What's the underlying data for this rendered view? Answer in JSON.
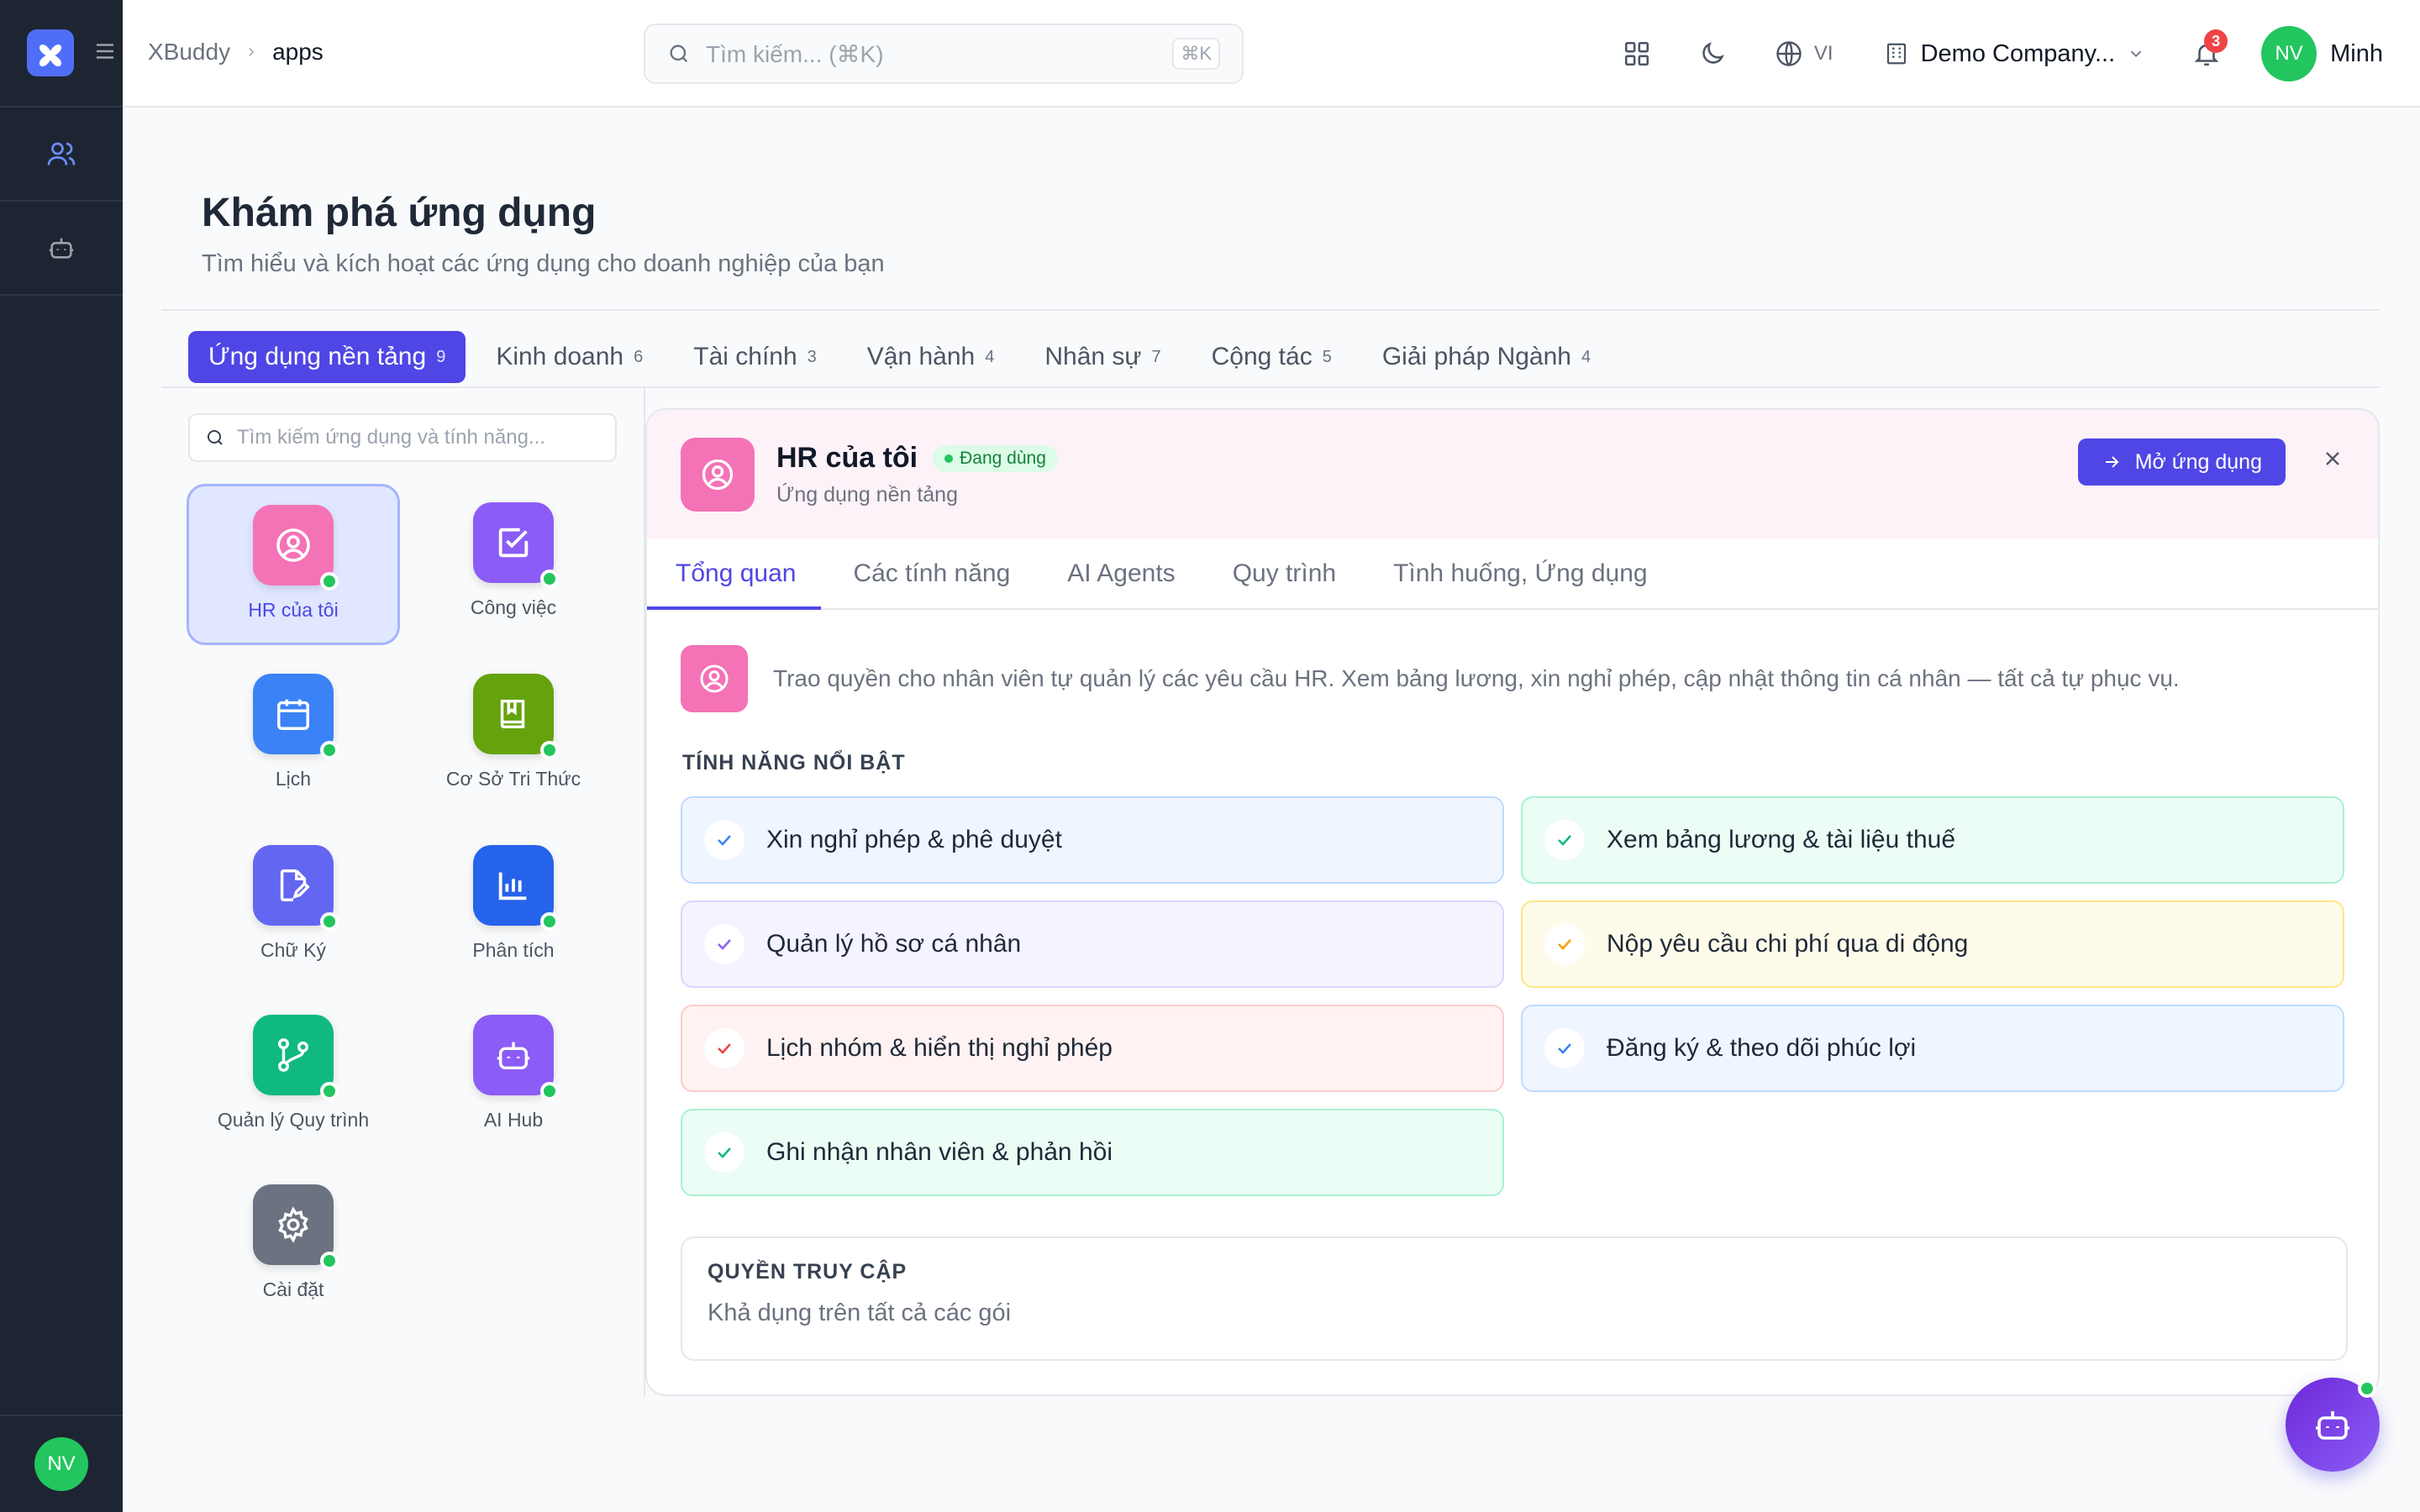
{
  "sidebar": {
    "avatar": "NV"
  },
  "header": {
    "breadcrumb": [
      "XBuddy",
      "apps"
    ],
    "search_placeholder": "Tìm kiếm... (⌘K)",
    "search_shortcut": "⌘K",
    "language": "VI",
    "company": "Demo Company...",
    "notification_count": "3",
    "user_initials": "NV",
    "user_name": "Minh"
  },
  "page": {
    "title": "Khám phá ứng dụng",
    "subtitle": "Tìm hiểu và kích hoạt các ứng dụng cho doanh nghiệp của bạn"
  },
  "categories": [
    {
      "label": "Ứng dụng nền tảng",
      "count": "9"
    },
    {
      "label": "Kinh doanh",
      "count": "6"
    },
    {
      "label": "Tài chính",
      "count": "3"
    },
    {
      "label": "Vận hành",
      "count": "4"
    },
    {
      "label": "Nhân sự",
      "count": "7"
    },
    {
      "label": "Cộng tác",
      "count": "5"
    },
    {
      "label": "Giải pháp Ngành",
      "count": "4"
    }
  ],
  "app_search_placeholder": "Tìm kiếm ứng dụng và tính năng...",
  "apps": [
    {
      "label": "HR của tôi",
      "icon": "user-circle-icon",
      "color": "#f472b6"
    },
    {
      "label": "Công việc",
      "icon": "check-square-icon",
      "color": "#8b5cf6"
    },
    {
      "label": "Lịch",
      "icon": "calendar-icon",
      "color": "#3b82f6"
    },
    {
      "label": "Cơ Sở Tri Thức",
      "icon": "book-icon",
      "color": "#65a30d"
    },
    {
      "label": "Chữ Ký",
      "icon": "signature-icon",
      "color": "#6366f1"
    },
    {
      "label": "Phân tích",
      "icon": "bar-chart-icon",
      "color": "#2563eb"
    },
    {
      "label": "Quản lý Quy trình",
      "icon": "workflow-icon",
      "color": "#10b981"
    },
    {
      "label": "AI Hub",
      "icon": "bot-icon",
      "color": "#8b5cf6"
    },
    {
      "label": "Cài đặt",
      "icon": "gear-icon",
      "color": "#6b7280"
    }
  ],
  "detail": {
    "name": "HR của tôi",
    "status": "Đang dùng",
    "category": "Ứng dụng nền tảng",
    "open_label": "Mở ứng dụng",
    "tabs": [
      "Tổng quan",
      "Các tính năng",
      "AI Agents",
      "Quy trình",
      "Tình huống, Ứng dụng"
    ],
    "description": "Trao quyền cho nhân viên tự quản lý các yêu cầu HR. Xem bảng lương, xin nghỉ phép, cập nhật thông tin cá nhân — tất cả tự phục vụ.",
    "features_heading": "TÍNH NĂNG NỔI BẬT",
    "features": [
      {
        "label": "Xin nghỉ phép & phê duyệt",
        "bg": "#eff6ff",
        "border": "#bfdbfe",
        "check": "#3b82f6"
      },
      {
        "label": "Xem bảng lương & tài liệu thuế",
        "bg": "#ecfdf5",
        "border": "#a7f3d0",
        "check": "#10b981"
      },
      {
        "label": "Quản lý hồ sơ cá nhân",
        "bg": "#f5f3ff",
        "border": "#ddd6fe",
        "check": "#8b5cf6"
      },
      {
        "label": "Nộp yêu cầu chi phí qua di động",
        "bg": "#fffbeb",
        "border": "#fde68a",
        "check": "#f59e0b"
      },
      {
        "label": "Lịch nhóm & hiển thị nghỉ phép",
        "bg": "#fef2f2",
        "border": "#fecaca",
        "check": "#ef4444"
      },
      {
        "label": "Đăng ký & theo dõi phúc lợi",
        "bg": "#eff6ff",
        "border": "#bfdbfe",
        "check": "#3b82f6"
      },
      {
        "label": "Ghi nhận nhân viên & phản hồi",
        "bg": "#ecfdf5",
        "border": "#a7f3d0",
        "check": "#10b981"
      }
    ],
    "access_heading": "QUYỀN TRUY CẬP",
    "access_value": "Khả dụng trên tất cả các gói"
  }
}
